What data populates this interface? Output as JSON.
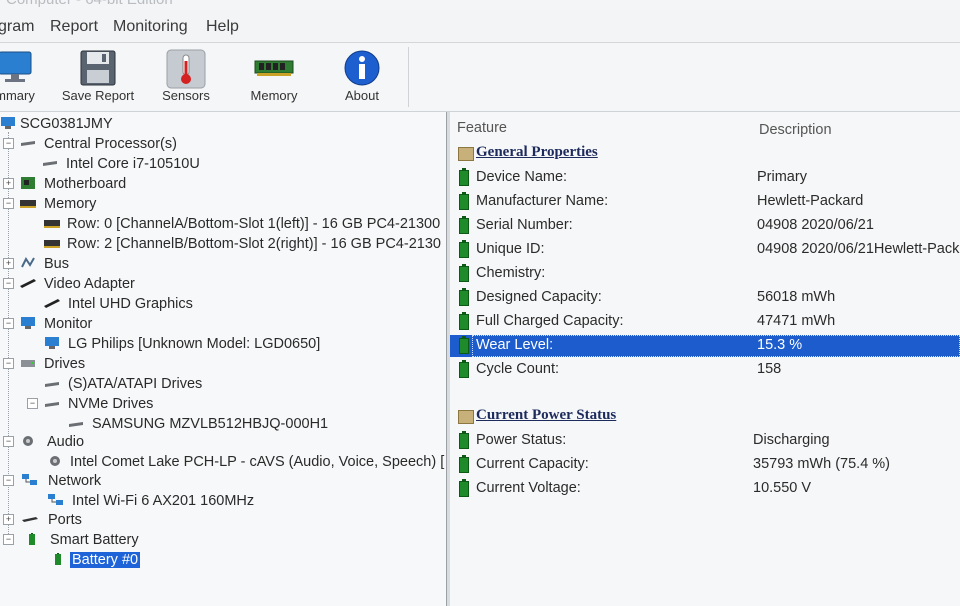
{
  "title_fragment": "Computer - 64-bit Edition",
  "menu": [
    "gram",
    "Report",
    "Monitoring",
    "Help"
  ],
  "toolbar": [
    {
      "label": "mmary",
      "icon": "monitor-icon"
    },
    {
      "label": "Save Report",
      "icon": "floppy-disk-icon"
    },
    {
      "label": "Sensors",
      "icon": "thermometer-icon"
    },
    {
      "label": "Memory",
      "icon": "memory-module-icon"
    },
    {
      "label": "About",
      "icon": "info-icon"
    }
  ],
  "tree": {
    "root": "SCG0381JMY",
    "cpu": "Central Processor(s)",
    "cpu_item": "Intel Core i7-10510U",
    "motherboard": "Motherboard",
    "memory": "Memory",
    "memory_row0": "Row: 0 [ChannelA/Bottom-Slot 1(left)] - 16 GB PC4-21300",
    "memory_row2": "Row: 2 [ChannelB/Bottom-Slot 2(right)] - 16 GB PC4-2130",
    "bus": "Bus",
    "video": "Video Adapter",
    "video_item": "Intel UHD Graphics",
    "monitor": "Monitor",
    "monitor_item": "LG Philips [Unknown Model: LGD0650]",
    "drives": "Drives",
    "drives_sata": "(S)ATA/ATAPI Drives",
    "drives_nvme": "NVMe Drives",
    "drives_nvme_item": "SAMSUNG MZVLB512HBJQ-000H1",
    "audio": "Audio",
    "audio_item": "Intel Comet Lake PCH-LP - cAVS (Audio, Voice, Speech) [",
    "network": "Network",
    "network_item": "Intel Wi-Fi 6 AX201 160MHz",
    "ports": "Ports",
    "battery": "Smart Battery",
    "battery_item": "Battery #0"
  },
  "details": {
    "col_feature": "Feature",
    "col_description": "Description",
    "section1": "General Properties",
    "rows1": [
      {
        "feature": "Device Name:",
        "value": "Primary"
      },
      {
        "feature": "Manufacturer Name:",
        "value": "Hewlett-Packard"
      },
      {
        "feature": "Serial Number:",
        "value": "04908 2020/06/21"
      },
      {
        "feature": "Unique ID:",
        "value": "04908 2020/06/21Hewlett-Pack"
      },
      {
        "feature": "Chemistry:",
        "value": ""
      },
      {
        "feature": "Designed Capacity:",
        "value": "56018 mWh"
      },
      {
        "feature": "Full Charged Capacity:",
        "value": "47471 mWh"
      },
      {
        "feature": "Wear Level:",
        "value": "15.3 %"
      },
      {
        "feature": "Cycle Count:",
        "value": "158"
      }
    ],
    "section2": "Current Power Status",
    "rows2": [
      {
        "feature": "Power Status:",
        "value": "Discharging"
      },
      {
        "feature": "Current Capacity:",
        "value": "35793 mWh (75.4 %)"
      },
      {
        "feature": "Current Voltage:",
        "value": "10.550 V"
      }
    ]
  }
}
